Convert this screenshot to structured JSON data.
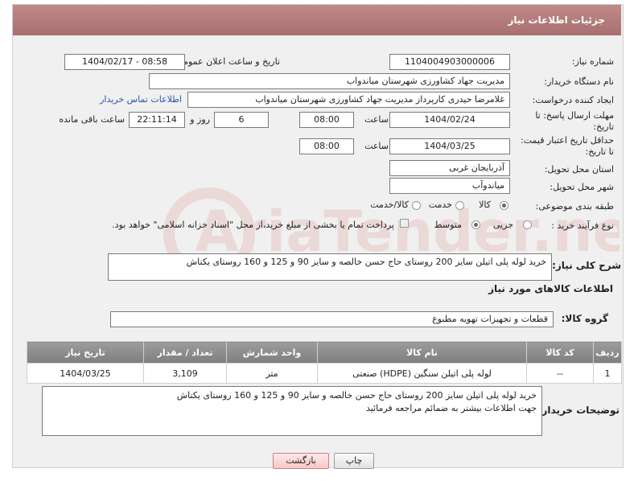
{
  "header": {
    "title": "جزئیات اطلاعات نیاز"
  },
  "fields": {
    "need_number_label": "شماره نیاز:",
    "need_number": "1104004903000006",
    "announce_label": "تاریخ و ساعت اعلان عمومی:",
    "announce_value": "1404/02/17 - 08:58",
    "buyer_org_label": "نام دستگاه خریدار:",
    "buyer_org": "مدیریت جهاد کشاورزی شهرستان میاندواب",
    "requester_label": "ایجاد کننده درخواست:",
    "requester": "غلامرضا حیدری کارپرداز مدیریت جهاد کشاورزی شهرستان میاندواب",
    "contact_link": "اطلاعات تماس خریدار",
    "deadline_label_1": "مهلت ارسال پاسخ: تا",
    "deadline_label_2": "تاریخ:",
    "deadline_date": "1404/02/24",
    "time_label": "ساعت",
    "deadline_time": "08:00",
    "days_value": "6",
    "days_label": "روز و",
    "remaining_time": "22:11:14",
    "remaining_label": "ساعت باقی مانده",
    "validity_label_1": "حداقل تاریخ اعتبار قیمت:",
    "validity_label_2": "تا تاریخ:",
    "validity_date": "1404/03/25",
    "validity_time": "08:00",
    "province_label": "استان محل تحویل:",
    "province": "آذربایجان غربی",
    "city_label": "شهر محل تحویل:",
    "city": "میاندوآب",
    "category_label": "طبقه بندی موضوعی:",
    "category_options": [
      "کالا",
      "خدمت",
      "کالا/خدمت"
    ],
    "category_selected": "کالا",
    "process_label": "نوع فرآیند خرید :",
    "process_options": [
      "جزیی",
      "متوسط"
    ],
    "process_note": "پرداخت تمام یا بخشی از مبلغ خرید،از محل \"اسناد خزانه اسلامی\" خواهد بود.",
    "summary_label": "شرح کلی نیاز:",
    "summary": "خرید لوله پلی اتیلن سایز 200 روستای حاج حسن خالصه و سایز 90 و 125 و 160 روستای یکتاش",
    "goods_info_title": "اطلاعات کالاهای مورد نیاز",
    "goods_group_label": "گروه کالا:",
    "goods_group": "قطعات و تجهیزات تهویه مطبوع"
  },
  "table": {
    "headers": [
      "ردیف",
      "کد کالا",
      "نام کالا",
      "واحد شمارش",
      "تعداد / مقدار",
      "تاریخ نیاز"
    ],
    "rows": [
      [
        "1",
        "--",
        "لوله پلی اتیلن سنگین (HDPE) صنعتی",
        "متر",
        "3,109",
        "1404/03/25"
      ]
    ]
  },
  "buyer_notes_label": "توضیحات خریدار:",
  "buyer_notes": "خرید لوله پلی اتیلن سایز 200 روستای حاج حسن خالصه و سایز 90 و 125 و 160 روستای یکتاش\nجهت اطلاعات بیشتر به ضمائم مراجعه فرمائید",
  "buttons": {
    "print": "چاپ",
    "back": "بازگشت"
  },
  "watermark": "AriaTender.net",
  "colors": {
    "header": "#b07878",
    "link": "#2a55a8",
    "watermark": "#c0392b"
  }
}
